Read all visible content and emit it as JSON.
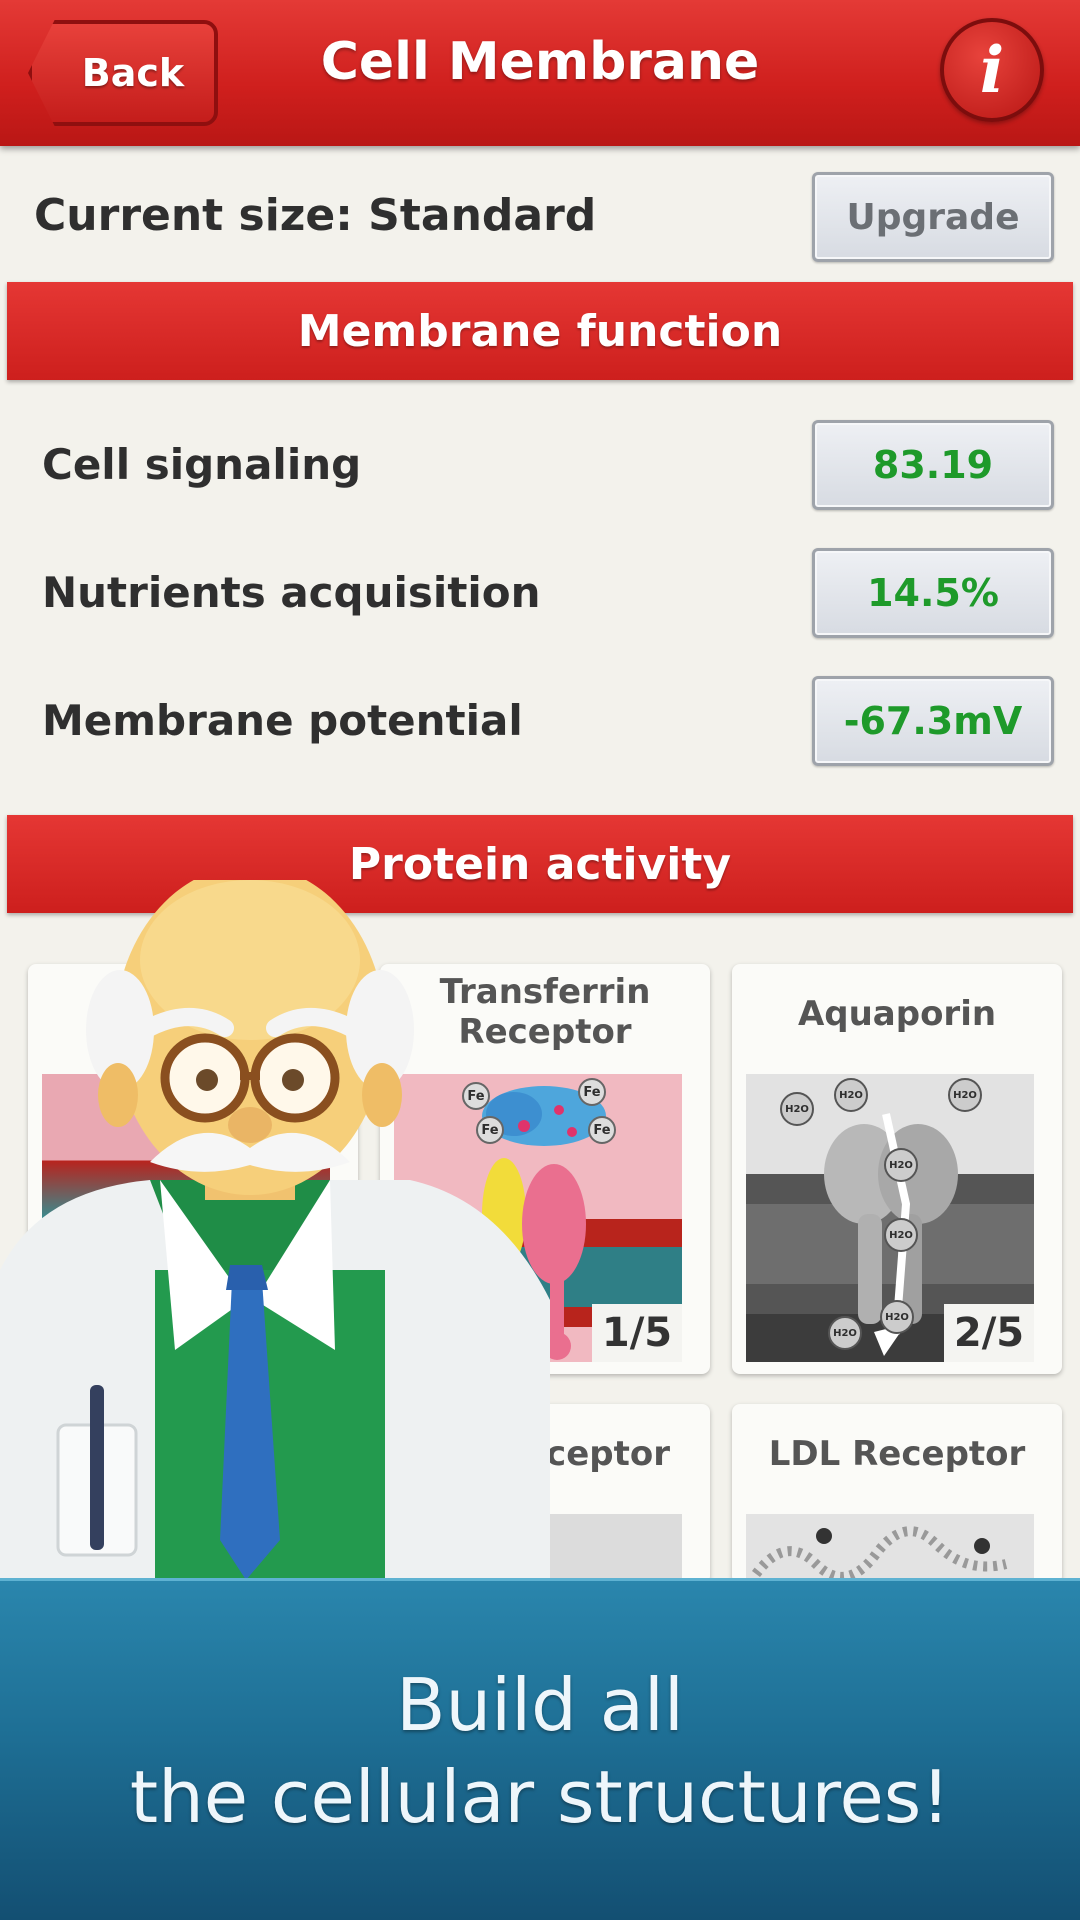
{
  "header": {
    "back_label": "Back",
    "title": "Cell Membrane",
    "info_label": "i"
  },
  "size_row": {
    "label": "Current size: Standard",
    "upgrade_label": "Upgrade"
  },
  "membrane_function": {
    "heading": "Membrane function",
    "stats": [
      {
        "label": "Cell signaling",
        "value": "83.19"
      },
      {
        "label": "Nutrients acquisition",
        "value": "14.5%"
      },
      {
        "label": "Membrane potential",
        "value": "-67.3mV"
      }
    ]
  },
  "protein_activity": {
    "heading": "Protein activity",
    "cards": [
      {
        "title_line1": "Transferrin",
        "title_line2": "Receptor",
        "count": "1/5",
        "labels": [
          "Fe",
          "Fe",
          "Fe",
          "Fe"
        ]
      },
      {
        "title": "Aquaporin",
        "count": "2/5",
        "labels": [
          "H2O",
          "H2O",
          "H2O",
          "H2O",
          "H2O",
          "H2O",
          "H2O"
        ]
      },
      {
        "title": "eceptor"
      },
      {
        "title": "LDL Receptor"
      }
    ]
  },
  "promo": {
    "line1": "Build all",
    "line2": "the cellular structures!"
  },
  "colors": {
    "header_red": "#cf1f1d",
    "value_green": "#1e9a2a",
    "promo_blue": "#1e6f95"
  }
}
